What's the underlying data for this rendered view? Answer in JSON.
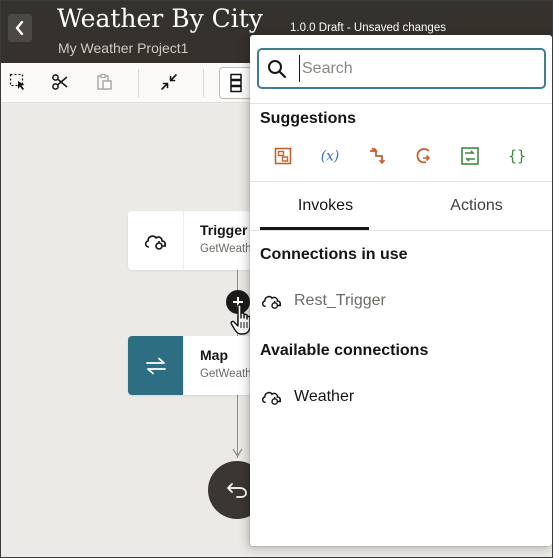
{
  "header": {
    "title": "Weather By City",
    "project": "My Weather Project1",
    "status": "1.0.0 Draft - Unsaved changes"
  },
  "toolbar": {
    "icons": [
      "select-icon",
      "cut-icon",
      "paste-icon",
      "collapse-icon",
      "layout-icon"
    ]
  },
  "canvas": {
    "trigger_node": {
      "title": "Trigger",
      "subtitle": "GetWeath"
    },
    "map_node": {
      "title": "Map",
      "subtitle": "GetWeath"
    }
  },
  "panel": {
    "search": {
      "placeholder": "Search",
      "value": ""
    },
    "suggestions_title": "Suggestions",
    "suggestion_icons": [
      "stage-file-icon",
      "variable-icon",
      "for-each-icon",
      "while-loop-icon",
      "data-stitch-icon",
      "json-icon"
    ],
    "tabs": [
      {
        "label": "Invokes",
        "active": true
      },
      {
        "label": "Actions",
        "active": false
      }
    ],
    "connections_in_use_title": "Connections in use",
    "connections_in_use": [
      {
        "label": "Rest_Trigger"
      }
    ],
    "available_connections_title": "Available connections",
    "available_connections": [
      {
        "label": "Weather"
      }
    ]
  },
  "colors": {
    "header_bg": "#35312c",
    "search_border": "#3f7d94",
    "map_node_bg": "#2e6e82",
    "suggestion_orange": "#c0632e",
    "suggestion_blue": "#3b6fb0",
    "suggestion_green": "#3f8a3f"
  }
}
